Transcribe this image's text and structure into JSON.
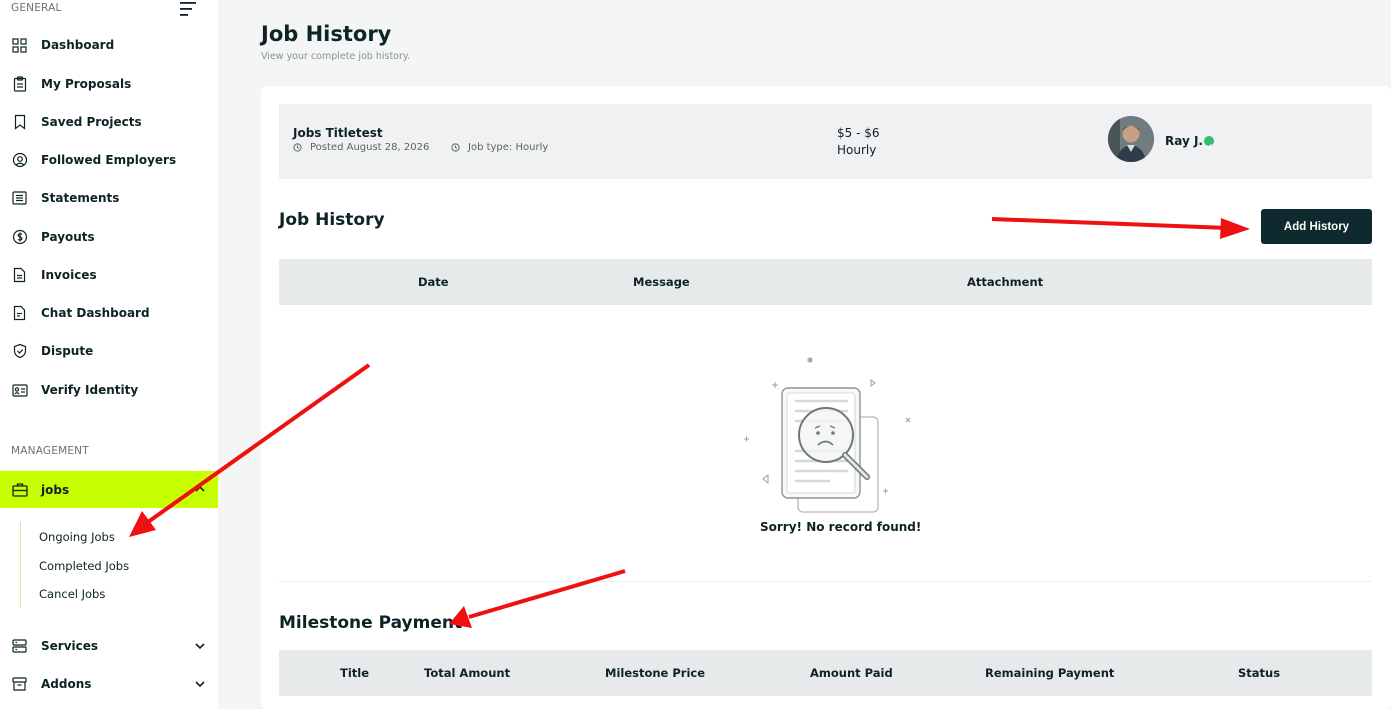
{
  "sidebar": {
    "general_label": "GENERAL",
    "management_label": "MANAGEMENT",
    "items": [
      {
        "label": "Dashboard",
        "icon": "grid-icon"
      },
      {
        "label": "My Proposals",
        "icon": "clipboard-icon"
      },
      {
        "label": "Saved Projects",
        "icon": "bookmark-icon"
      },
      {
        "label": "Followed Employers",
        "icon": "user-circle-icon"
      },
      {
        "label": "Statements",
        "icon": "list-icon"
      },
      {
        "label": "Payouts",
        "icon": "dollar-icon"
      },
      {
        "label": "Invoices",
        "icon": "document-icon"
      },
      {
        "label": "Chat Dashboard",
        "icon": "chat-doc-icon"
      },
      {
        "label": "Dispute",
        "icon": "shield-icon"
      },
      {
        "label": "Verify Identity",
        "icon": "id-card-icon"
      }
    ],
    "jobs": {
      "label": "jobs",
      "icon": "briefcase-icon",
      "sub_items": [
        "Ongoing Jobs",
        "Completed Jobs",
        "Cancel Jobs"
      ]
    },
    "services": {
      "label": "Services",
      "icon": "server-icon"
    },
    "addons": {
      "label": "Addons",
      "icon": "archive-icon"
    }
  },
  "page": {
    "title": "Job History",
    "subtitle": "View your complete job history."
  },
  "job": {
    "title": "Jobs Titletest",
    "posted": "Posted August 28, 2026",
    "job_type": "Job type: Hourly",
    "price": "$5 - $6",
    "rate": "Hourly",
    "user_name": "Ray J."
  },
  "history": {
    "heading": "Job History",
    "add_button": "Add History",
    "columns": [
      "Date",
      "Message",
      "Attachment"
    ],
    "empty_text": "Sorry! No record found!"
  },
  "milestone": {
    "heading": "Milestone Payment",
    "columns": [
      "Title",
      "Total Amount",
      "Milestone Price",
      "Amount Paid",
      "Remaining Payment",
      "Status"
    ]
  },
  "colors": {
    "accent": "#c8ff00",
    "dark": "#0f2a2e",
    "annotation_arrow": "#ee1111",
    "verified": "#2fbf71"
  }
}
